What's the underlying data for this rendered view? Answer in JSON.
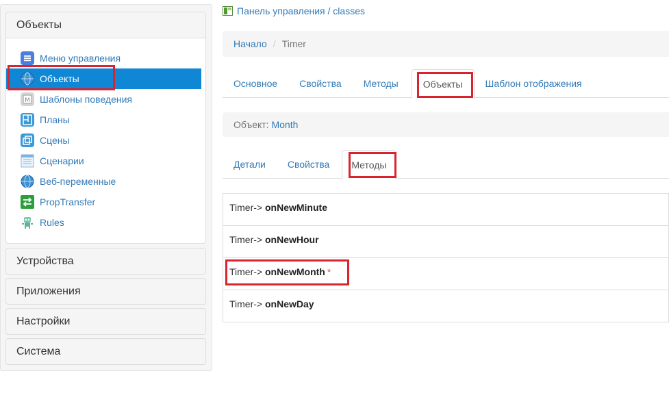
{
  "sidebar": {
    "sections": [
      {
        "title": "Объекты"
      },
      {
        "title": "Устройства"
      },
      {
        "title": "Приложения"
      },
      {
        "title": "Настройки"
      },
      {
        "title": "Система"
      }
    ],
    "items": [
      {
        "label": "Меню управления",
        "icon": "menu-icon"
      },
      {
        "label": "Объекты",
        "icon": "globe-icon"
      },
      {
        "label": "Шаблоны поведения",
        "icon": "template-icon"
      },
      {
        "label": "Планы",
        "icon": "plan-icon"
      },
      {
        "label": "Сцены",
        "icon": "scenes-icon"
      },
      {
        "label": "Сценарии",
        "icon": "scripts-icon"
      },
      {
        "label": "Веб-переменные",
        "icon": "globe-icon"
      },
      {
        "label": "PropTransfer",
        "icon": "transfer-icon"
      },
      {
        "label": "Rules",
        "icon": "robot-icon"
      }
    ],
    "active_item": "Объекты"
  },
  "header": {
    "control_panel": "Панель управления",
    "separator": " / ",
    "section": "classes"
  },
  "breadcrumb": {
    "home": "Начало",
    "separator": "/",
    "current": "Timer"
  },
  "class_tabs": [
    {
      "label": "Основное"
    },
    {
      "label": "Свойства"
    },
    {
      "label": "Методы"
    },
    {
      "label": "Объекты"
    },
    {
      "label": "Шаблон отображения"
    }
  ],
  "class_tabs_active": "Объекты",
  "object": {
    "label": "Объект:",
    "name": "Month"
  },
  "object_tabs": [
    {
      "label": "Детали"
    },
    {
      "label": "Свойства"
    },
    {
      "label": "Методы"
    }
  ],
  "object_tabs_active": "Методы",
  "methods": [
    {
      "prefix": "Timer->",
      "name": "onNewMinute",
      "mark": ""
    },
    {
      "prefix": "Timer->",
      "name": "onNewHour",
      "mark": ""
    },
    {
      "prefix": "Timer->",
      "name": "onNewMonth",
      "mark": "*"
    },
    {
      "prefix": "Timer->",
      "name": "onNewDay",
      "mark": ""
    }
  ],
  "colors": {
    "link": "#337ab7",
    "active_menu_bg": "#0f87d4",
    "highlight_frame": "#d9232e",
    "override_marker": "#d9534f"
  }
}
